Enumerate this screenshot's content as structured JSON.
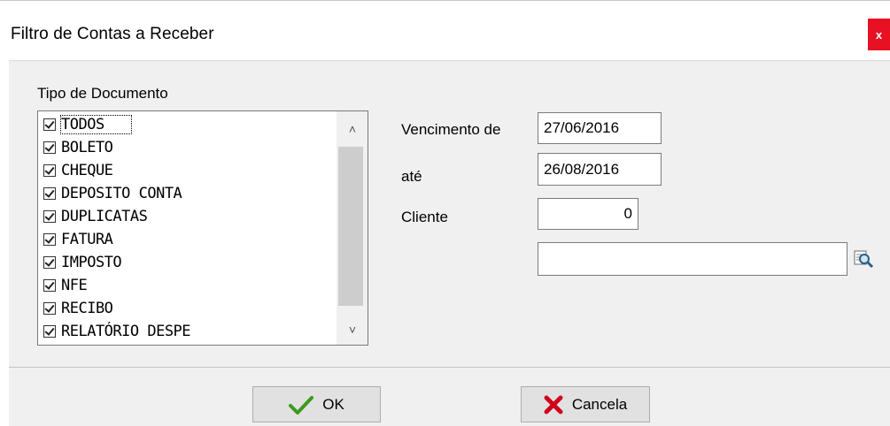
{
  "window": {
    "title": "Filtro de Contas a Receber",
    "close_label": "x"
  },
  "document_types": {
    "label": "Tipo de Documento",
    "items": [
      {
        "label": "TODOS",
        "checked": true
      },
      {
        "label": "BOLETO",
        "checked": true
      },
      {
        "label": "CHEQUE",
        "checked": true
      },
      {
        "label": "DEPOSITO CONTA",
        "checked": true
      },
      {
        "label": "DUPLICATAS",
        "checked": true
      },
      {
        "label": "FATURA",
        "checked": true
      },
      {
        "label": "IMPOSTO",
        "checked": true
      },
      {
        "label": "NFE",
        "checked": true
      },
      {
        "label": "RECIBO",
        "checked": true
      },
      {
        "label": "RELATÓRIO DESPE",
        "checked": true
      }
    ],
    "scroll_up_glyph": "˄",
    "scroll_down_glyph": "˅"
  },
  "filters": {
    "due_from_label": "Vencimento de",
    "due_from_value": "27/06/2016",
    "due_to_label": "até",
    "due_to_value": "26/08/2016",
    "client_label": "Cliente",
    "client_code": "0",
    "client_name": ""
  },
  "buttons": {
    "ok_label": "OK",
    "cancel_label": "Cancela"
  },
  "colors": {
    "close": "#e81123",
    "ok_check": "#3c9a1e",
    "cancel_x": "#d0021b"
  }
}
